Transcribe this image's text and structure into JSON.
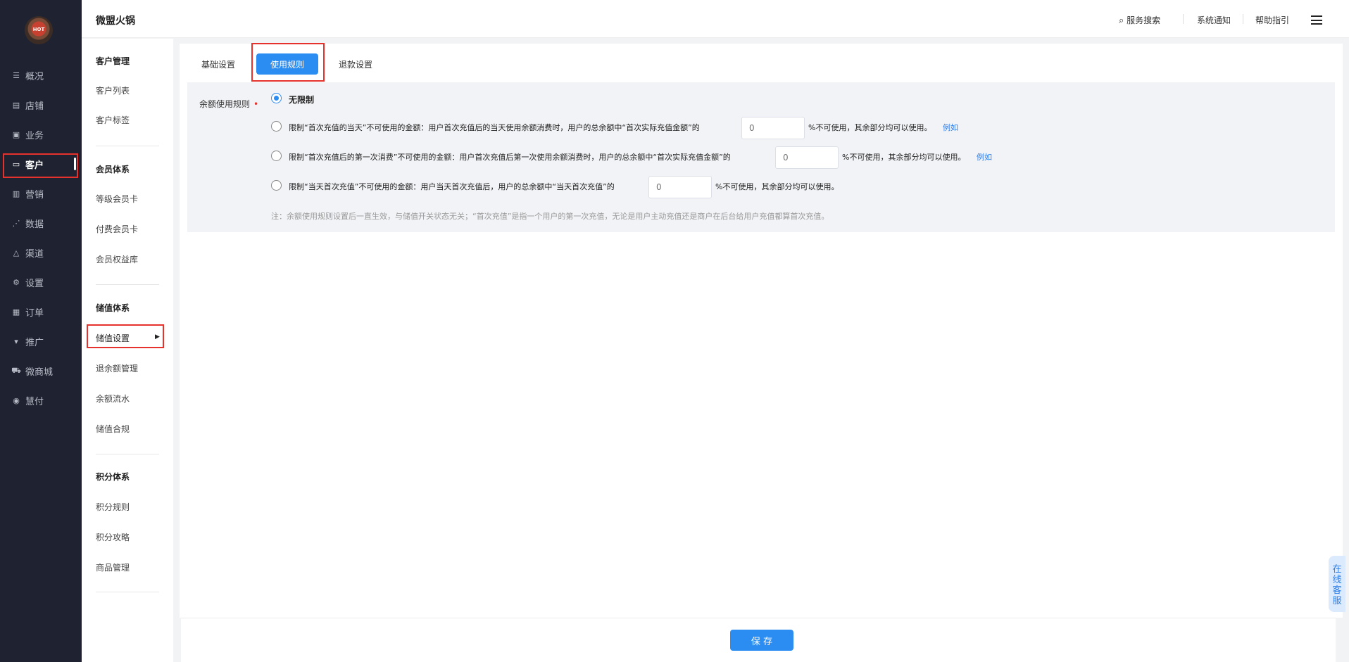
{
  "logo_text": "HOT",
  "nav": {
    "items": [
      {
        "label": "概况",
        "icon": "list-icon"
      },
      {
        "label": "店铺",
        "icon": "store-icon"
      },
      {
        "label": "业务",
        "icon": "briefcase-icon"
      },
      {
        "label": "客户",
        "icon": "customer-card-icon"
      },
      {
        "label": "营销",
        "icon": "bar-chart-icon"
      },
      {
        "label": "数据",
        "icon": "line-chart-icon"
      },
      {
        "label": "渠道",
        "icon": "channel-icon"
      },
      {
        "label": "设置",
        "icon": "gear-icon"
      },
      {
        "label": "订单",
        "icon": "order-icon"
      },
      {
        "label": "推广",
        "icon": "promote-icon"
      },
      {
        "label": "微商城",
        "icon": "cart-icon"
      },
      {
        "label": "慧付",
        "icon": "pay-icon"
      }
    ],
    "active": "客户"
  },
  "header": {
    "brand": "微盟火锅",
    "search_label": "服务搜索",
    "notice_label": "系统通知",
    "help_label": "帮助指引"
  },
  "subnav": {
    "groups": [
      {
        "title": "客户管理",
        "items": [
          "客户列表",
          "客户标签"
        ]
      },
      {
        "title": "会员体系",
        "items": [
          "等级会员卡",
          "付费会员卡",
          "会员权益库"
        ]
      },
      {
        "title": "储值体系",
        "items": [
          "储值设置",
          "退余额管理",
          "余额流水",
          "储值合规"
        ]
      },
      {
        "title": "积分体系",
        "items": [
          "积分规则",
          "积分攻略",
          "商品管理"
        ]
      }
    ],
    "active": "储值设置"
  },
  "tabs": {
    "basic": "基础设置",
    "usage": "使用规则",
    "refund": "退款设置"
  },
  "rules": {
    "label": "余额使用规则",
    "required_mark": "•",
    "options": [
      {
        "text": "无限制",
        "selected": true
      },
      {
        "text": "限制“首次充值的当天”不可使用的金额：用户首次充值后的当天使用余额消费时，用户的总余额中“首次实际充值金额”的",
        "placeholder": "0",
        "suffix": "%不可使用，其余部分均可以使用。",
        "link": "例如"
      },
      {
        "text": "限制“首次充值后的第一次消费”不可使用的金额：用户首次充值后第一次使用余额消费时，用户的总余额中“首次实际充值金额”的",
        "placeholder": "0",
        "suffix": "%不可使用，其余部分均可以使用。",
        "link": "例如"
      },
      {
        "text": "限制“当天首次充值”不可使用的金额：用户当天首次充值后，用户的总余额中“当天首次充值”的",
        "placeholder": "0",
        "suffix": "%不可使用，其余部分均可以使用。"
      }
    ],
    "note": "注：余额使用规则设置后一直生效，与储值开关状态无关；“首次充值”是指一个用户的第一次充值，无论是用户主动充值还是商户在后台给用户充值都算首次充值。"
  },
  "footer": {
    "save_label": "保 存"
  },
  "float_service": "在线客服",
  "colors": {
    "accent": "#2b8cf2",
    "nav_bg": "#1f2230",
    "highlight": "#e5322d"
  }
}
